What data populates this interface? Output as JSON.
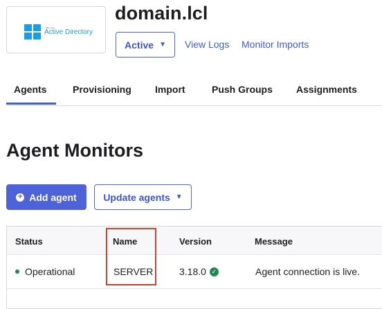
{
  "app": {
    "logo_small_text": "Microsoft",
    "logo_text": "Active Directory",
    "title": "domain.lcl",
    "status": "Active",
    "links": [
      "View Logs",
      "Monitor Imports"
    ]
  },
  "tabs": [
    {
      "label": "Agents",
      "active": true
    },
    {
      "label": "Provisioning"
    },
    {
      "label": "Import"
    },
    {
      "label": "Push Groups"
    },
    {
      "label": "Assignments"
    }
  ],
  "section": {
    "title": "Agent Monitors",
    "add_button": "Add agent",
    "update_button": "Update agents"
  },
  "table": {
    "columns": [
      "Status",
      "Name",
      "Version",
      "Message"
    ],
    "rows": [
      {
        "status": "Operational",
        "name": "SERVER",
        "version": "3.18.0",
        "message": "Agent connection is live."
      }
    ]
  },
  "colors": {
    "accent": "#3f5ed3",
    "primary_button": "#4e63d9",
    "status_ok": "#1e8a52",
    "highlight_box": "#c8442e",
    "logo_blue": "#1a9ce6"
  },
  "icons": {
    "logo": "windows-logo-icon",
    "dropdown": "caret-down-icon",
    "add": "plus-circle-icon",
    "status": "status-dot-icon",
    "version_ok": "check-circle-icon"
  }
}
